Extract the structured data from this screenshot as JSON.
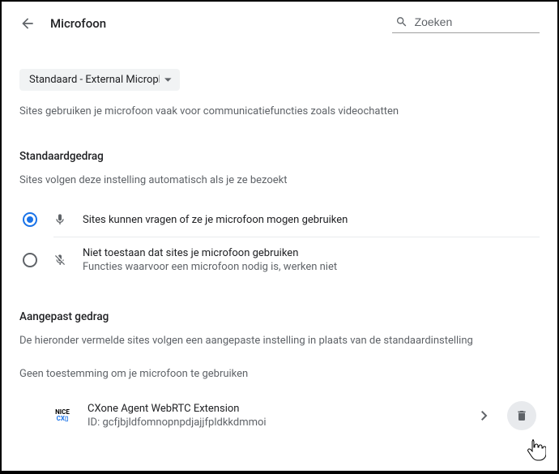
{
  "header": {
    "title": "Microfoon",
    "search_placeholder": "Zoeken"
  },
  "device_dropdown": {
    "label": "Standaard - External Microphone"
  },
  "intro_text": "Sites gebruiken je microfoon vaak voor communicatiefuncties zoals videochatten",
  "default_behavior": {
    "heading": "Standaardgedrag",
    "subtext": "Sites volgen deze instelling automatisch als je ze bezoekt",
    "options": [
      {
        "label": "Sites kunnen vragen of ze je microfoon mogen gebruiken",
        "sublabel": "",
        "selected": true
      },
      {
        "label": "Niet toestaan dat sites je microfoon gebruiken",
        "sublabel": "Functies waarvoor een microfoon nodig is, werken niet",
        "selected": false
      }
    ]
  },
  "custom_behavior": {
    "heading": "Aangepast gedrag",
    "subtext": "De hieronder vermelde sites volgen een aangepaste instelling in plaats van de standaardinstelling",
    "blocked_label": "Geen toestemming om je microfoon te gebruiken",
    "sites": [
      {
        "name": "CXone Agent WebRTC Extension",
        "id": "ID: gcfjbjldfomnopnpdjajjfpldkkdmmoi",
        "icon_line1": "NICE",
        "icon_line2": "CX▯"
      }
    ]
  }
}
